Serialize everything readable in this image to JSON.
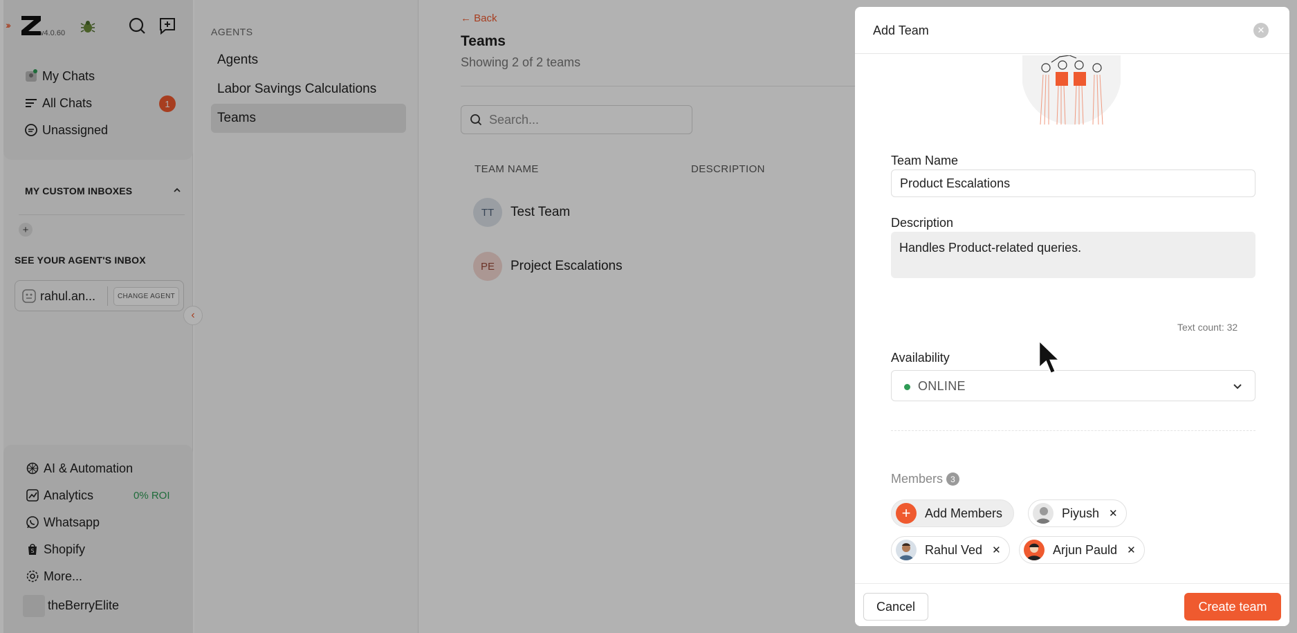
{
  "app": {
    "version": "v4.0.60"
  },
  "sidebar": {
    "primary": [
      {
        "label": "My Chats",
        "icon": "my-chats-icon"
      },
      {
        "label": "All Chats",
        "icon": "all-chats-icon",
        "badge": "1"
      },
      {
        "label": "Unassigned",
        "icon": "unassigned-icon"
      }
    ],
    "custom_inboxes_title": "MY CUSTOM INBOXES",
    "agent_inbox_title": "SEE YOUR AGENT'S INBOX",
    "agent_name": "rahul.an...",
    "change_agent_label": "CHANGE AGENT",
    "bottom": [
      {
        "label": "AI & Automation",
        "icon": "ai-icon"
      },
      {
        "label": "Analytics",
        "icon": "analytics-icon",
        "extra": "0% ROI"
      },
      {
        "label": "Whatsapp",
        "icon": "whatsapp-icon"
      },
      {
        "label": "Shopify",
        "icon": "shopify-icon"
      },
      {
        "label": "More...",
        "icon": "gear-icon"
      }
    ],
    "org_name": "theBerryElite"
  },
  "subnav": {
    "title": "AGENTS",
    "items": [
      {
        "label": "Agents"
      },
      {
        "label": "Labor Savings Calculations"
      },
      {
        "label": "Teams",
        "active": true
      }
    ]
  },
  "main": {
    "back_label": "← Back",
    "title": "Teams",
    "showing": "Showing 2 of 2 teams",
    "search_placeholder": "Search...",
    "columns": [
      "TEAM NAME",
      "DESCRIPTION"
    ],
    "rows": [
      {
        "initials": "TT",
        "name": "Test Team",
        "color": "#dde3ea",
        "text_color": "#50627a"
      },
      {
        "initials": "PE",
        "name": "Project Escalations",
        "color": "#f5d9d3",
        "text_color": "#9a4a3a"
      }
    ]
  },
  "drawer": {
    "title": "Add Team",
    "team_name_label": "Team Name",
    "team_name_value": "Product Escalations",
    "description_label": "Description",
    "description_value": "Handles Product-related queries.",
    "text_count": "Text count: 32",
    "availability_label": "Availability",
    "availability_value": "ONLINE",
    "members_label": "Members",
    "members_count": "3",
    "add_members_label": "Add Members",
    "members": [
      {
        "name": "Piyush"
      },
      {
        "name": "Rahul Ved"
      },
      {
        "name": "Arjun Pauld"
      }
    ],
    "remove_symbol": "✕",
    "cancel_label": "Cancel",
    "create_label": "Create team"
  },
  "colors": {
    "accent": "#ef5a2f",
    "online": "#2e9b55"
  }
}
